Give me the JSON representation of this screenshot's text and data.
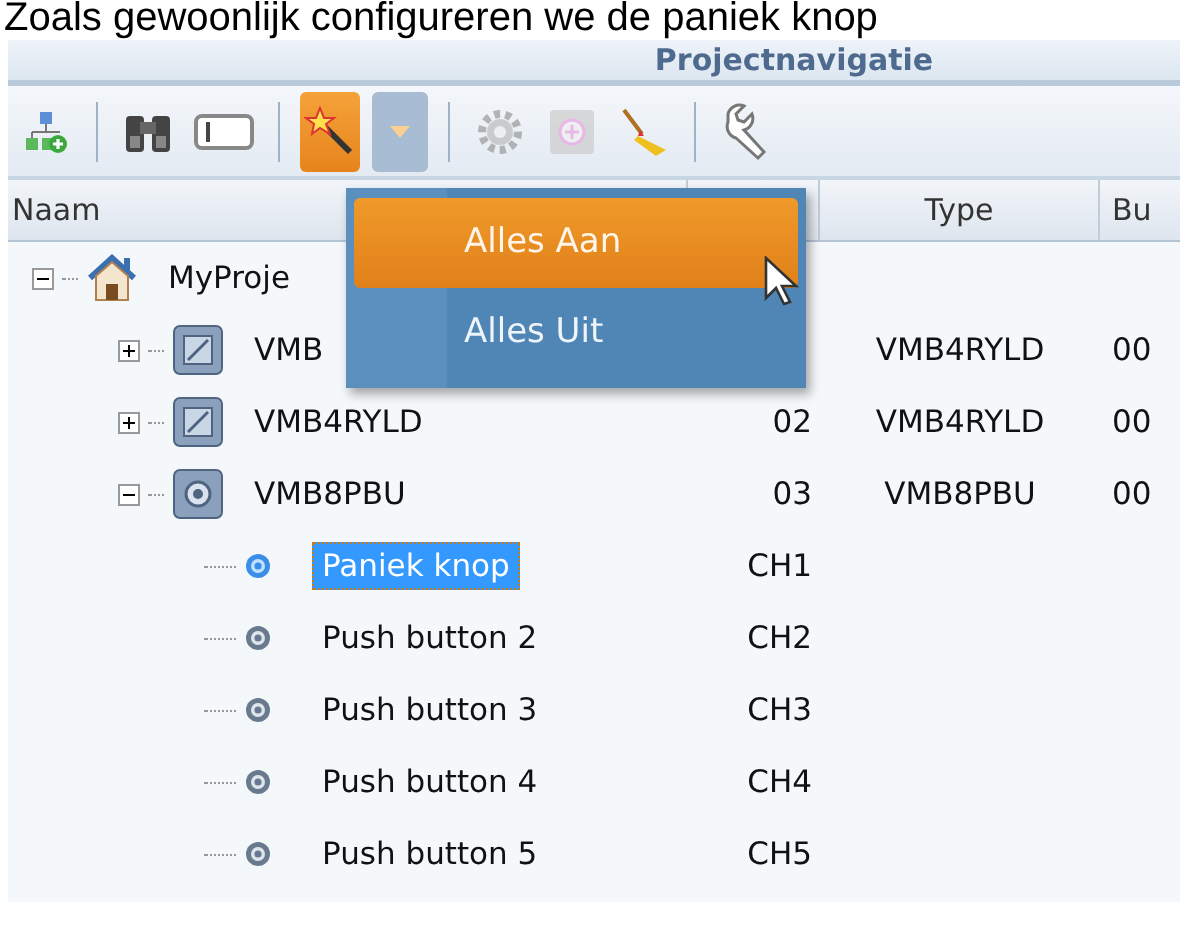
{
  "caption": "Zoals gewoonlijk configureren we de paniek knop",
  "panel": {
    "title": "Projectnavigatie"
  },
  "toolbar": [
    [
      {
        "kind": "add-node",
        "pressed": false,
        "disabled": false
      }
    ],
    [
      {
        "kind": "binoculars",
        "pressed": false,
        "disabled": false
      },
      {
        "kind": "panel",
        "pressed": false,
        "disabled": false
      }
    ],
    [
      {
        "kind": "wand",
        "pressed": true,
        "disabled": false
      },
      {
        "kind": "dropdown",
        "pressed": true,
        "disabled": false
      }
    ],
    [
      {
        "kind": "gear",
        "pressed": false,
        "disabled": true
      },
      {
        "kind": "plus",
        "pressed": false,
        "disabled": true
      },
      {
        "kind": "broom",
        "pressed": false,
        "disabled": false
      }
    ],
    [
      {
        "kind": "wrench",
        "pressed": false,
        "disabled": false
      }
    ]
  ],
  "columns": [
    "Naam",
    "Type",
    "Bu"
  ],
  "tree": [
    {
      "kind": "project",
      "name": "MyProje",
      "expanded": true,
      "selected": false,
      "children": [
        {
          "kind": "relay",
          "name": "VMB",
          "type": "VMB4RYLD",
          "bus": "00",
          "expanded": false,
          "selected": false
        },
        {
          "kind": "relay",
          "name": "VMB4RYLD",
          "address": "02",
          "type": "VMB4RYLD",
          "bus": "00",
          "expanded": false,
          "selected": false
        },
        {
          "kind": "module",
          "name": "VMB8PBU",
          "address": "03",
          "type": "VMB8PBU",
          "bus": "00",
          "expanded": true,
          "selected": false,
          "children": [
            {
              "kind": "channel",
              "name": "Paniek knop",
              "address": "CH1",
              "selected": true
            },
            {
              "kind": "channel",
              "name": "Push button 2",
              "address": "CH2",
              "selected": false
            },
            {
              "kind": "channel",
              "name": "Push button 3",
              "address": "CH3",
              "selected": false
            },
            {
              "kind": "channel",
              "name": "Push button 4",
              "address": "CH4",
              "selected": false
            },
            {
              "kind": "channel",
              "name": "Push button 5",
              "address": "CH5",
              "selected": false
            }
          ]
        }
      ]
    }
  ],
  "menu": [
    {
      "label": "Alles Aan",
      "selected": true
    },
    {
      "label": "Alles Uit",
      "selected": false
    }
  ]
}
